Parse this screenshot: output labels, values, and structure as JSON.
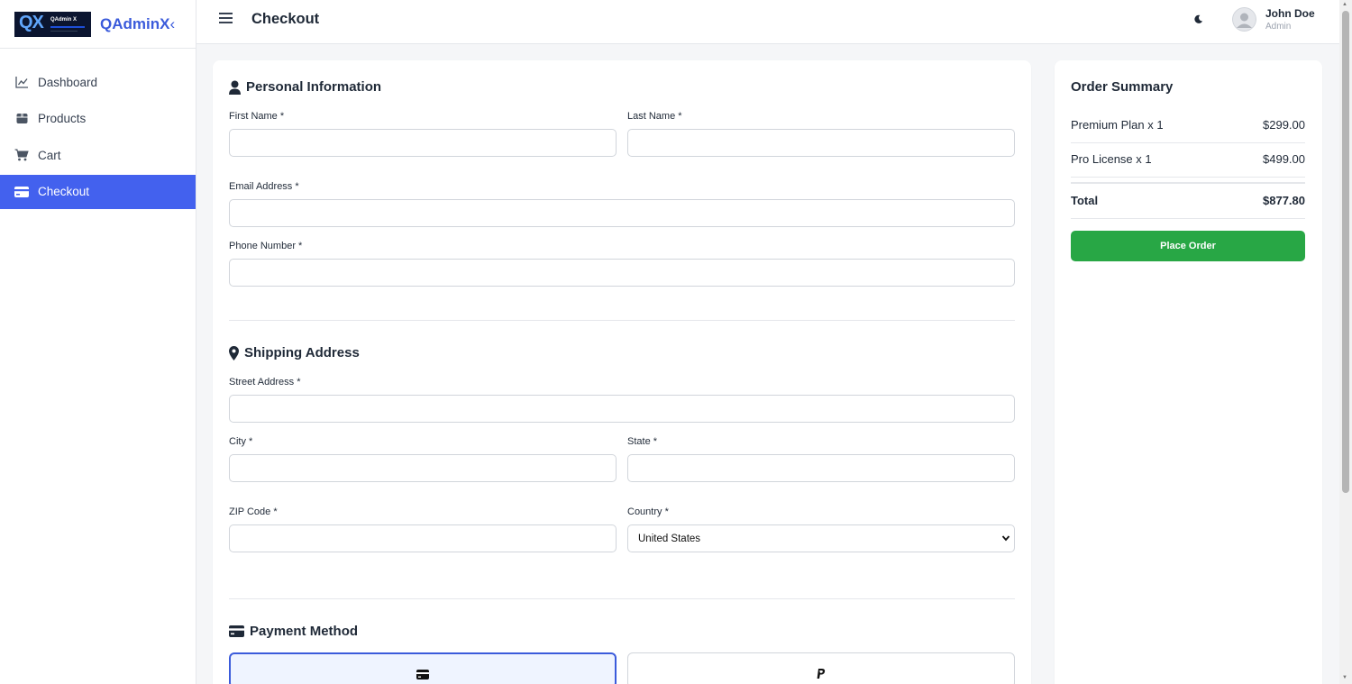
{
  "brand": {
    "logo_text": "QX",
    "logo_sub": "QAdmin X",
    "name": "QAdminX"
  },
  "sidebar": {
    "items": [
      {
        "label": "Dashboard",
        "icon": "chart-line-icon"
      },
      {
        "label": "Products",
        "icon": "box-icon"
      },
      {
        "label": "Cart",
        "icon": "cart-icon"
      },
      {
        "label": "Checkout",
        "icon": "credit-card-icon",
        "active": true
      }
    ]
  },
  "header": {
    "title": "Checkout",
    "user": {
      "name": "John Doe",
      "role": "Admin"
    }
  },
  "form": {
    "personal": {
      "title": "Personal Information",
      "first_name_label": "First Name *",
      "first_name_value": "",
      "last_name_label": "Last Name *",
      "last_name_value": "",
      "email_label": "Email Address *",
      "email_value": "",
      "phone_label": "Phone Number *",
      "phone_value": ""
    },
    "shipping": {
      "title": "Shipping Address",
      "street_label": "Street Address *",
      "street_value": "",
      "city_label": "City *",
      "city_value": "",
      "state_label": "State *",
      "state_value": "",
      "zip_label": "ZIP Code *",
      "zip_value": "",
      "country_label": "Country *",
      "country_value": "United States"
    },
    "payment": {
      "title": "Payment Method",
      "options": [
        {
          "icon": "credit-card-icon",
          "selected": true
        },
        {
          "icon": "paypal-icon",
          "selected": false
        }
      ]
    }
  },
  "summary": {
    "title": "Order Summary",
    "items": [
      {
        "name": "Premium Plan x 1",
        "price": "$299.00"
      },
      {
        "name": "Pro License x 1",
        "price": "$499.00"
      }
    ],
    "total_label": "Total",
    "total_value": "$877.80",
    "place_order_label": "Place Order"
  },
  "colors": {
    "accent": "#4361ee",
    "success": "#28a745",
    "brand": "#3b5bdb"
  }
}
